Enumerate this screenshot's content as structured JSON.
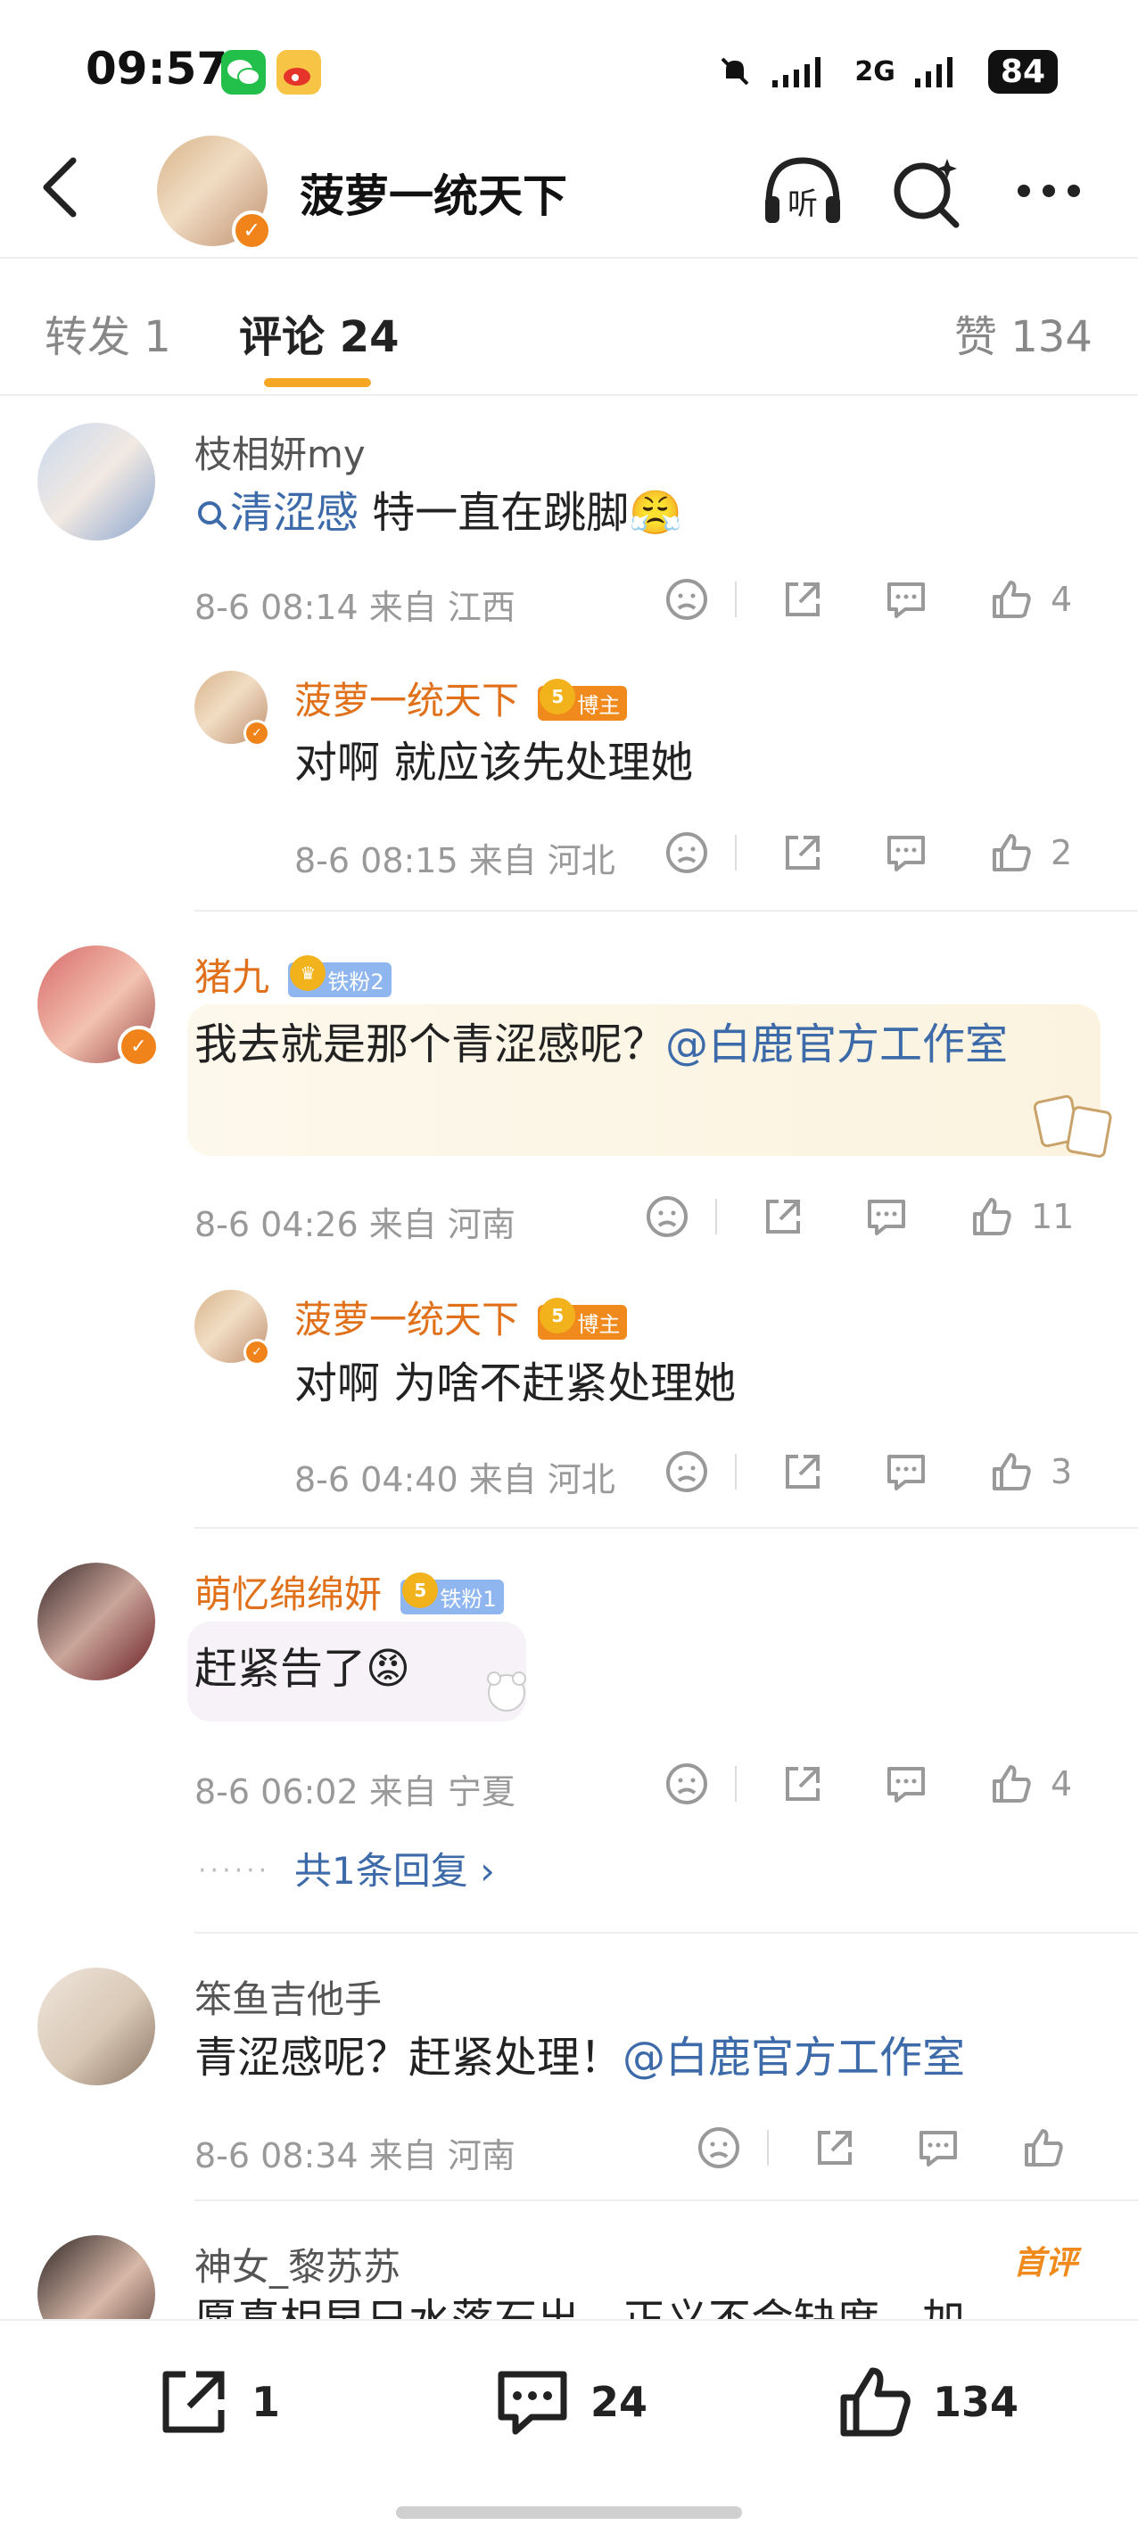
{
  "status_bar": {
    "time": "09:57",
    "network": "2G",
    "battery": "84",
    "apps": [
      "wechat-icon",
      "weibo-icon"
    ]
  },
  "header": {
    "title": "菠萝一统天下",
    "listen_label": "听"
  },
  "tabs": [
    {
      "label": "转发 1"
    },
    {
      "label": "评论 24"
    },
    {
      "label": "赞 134"
    }
  ],
  "comments": [
    {
      "user": "枝相妍my",
      "text_prefix": "清涩感",
      "text": " 特一直在跳脚😤",
      "meta": "8-6 08:14  来自 江西",
      "likes": "4",
      "reply": {
        "user": "菠萝一统天下",
        "badge": "博主",
        "text": "对啊 就应该先处理她",
        "meta": "8-6 08:15  来自 河北",
        "likes": "2"
      }
    },
    {
      "user": "猪九",
      "badge": "铁粉2",
      "text": "我去就是那个青涩感呢？",
      "mention": "@白鹿官方工作室",
      "meta": "8-6 04:26  来自 河南",
      "likes": "11",
      "reply": {
        "user": "菠萝一统天下",
        "badge": "博主",
        "text": "对啊 为啥不赶紧处理她",
        "meta": "8-6 04:40  来自 河北",
        "likes": "3"
      }
    },
    {
      "user": "萌忆绵绵妍",
      "badge": "铁粉1",
      "text": "赶紧告了😡",
      "meta": "8-6 06:02  来自 宁夏",
      "likes": "4",
      "more_replies": "共1条回复 ›"
    },
    {
      "user": "笨鱼吉他手",
      "text": "青涩感呢？赶紧处理！",
      "mention": "@白鹿官方工作室",
      "meta": "8-6 08:34  来自 河南",
      "likes": ""
    },
    {
      "user": "神女_黎苏苏",
      "tag": "首评",
      "text": "愿真相早日水落石出，正义不会缺席，加"
    }
  ],
  "bottom_bar": {
    "reposts": "1",
    "comments": "24",
    "likes": "134"
  },
  "colors": {
    "accent": "#f5a623",
    "name_orange": "#e0701a",
    "link": "#3d6aa8",
    "meta_gray": "#999999"
  }
}
